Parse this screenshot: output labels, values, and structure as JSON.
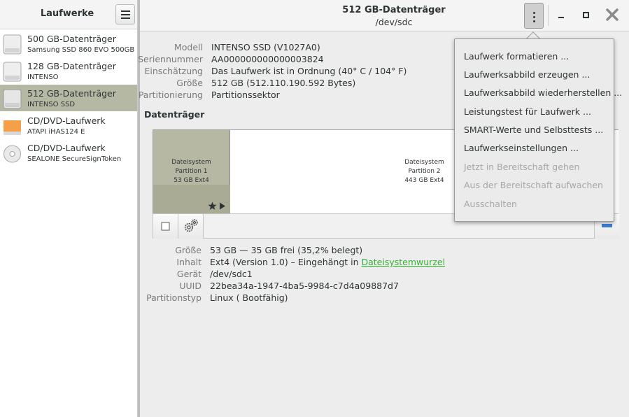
{
  "sidebar": {
    "title": "Laufwerke",
    "drives": [
      {
        "name": "500 GB-Datenträger",
        "sub": "Samsung SSD 860 EVO 500GB",
        "icon": "hard-disk-icon"
      },
      {
        "name": "128 GB-Datenträger",
        "sub": "INTENSO",
        "icon": "hard-disk-icon"
      },
      {
        "name": "512 GB-Datenträger",
        "sub": "INTENSO SSD",
        "icon": "hard-disk-icon",
        "selected": true
      },
      {
        "name": "CD/DVD-Laufwerk",
        "sub": "ATAPI   iHAS124   E",
        "icon": "optical-drive-icon"
      },
      {
        "name": "CD/DVD-Laufwerk",
        "sub": "SEALONE SecureSignToken",
        "icon": "optical-disc-icon"
      }
    ]
  },
  "header": {
    "title": "512 GB-Datenträger",
    "subtitle": "/dev/sdc"
  },
  "drive_info": [
    {
      "label": "Modell",
      "value": "INTENSO SSD (V1027A0)"
    },
    {
      "label": "Seriennummer",
      "value": "AA000000000000003824"
    },
    {
      "label": "Einschätzung",
      "value": "Das Laufwerk ist in Ordnung (40° C / 104° F)"
    },
    {
      "label": "Größe",
      "value": "512 GB (512.110.190.592 Bytes)"
    },
    {
      "label": "Partitionierung",
      "value": "Partitionssektor"
    }
  ],
  "volumes": {
    "section_title": "Datenträger",
    "partitions": [
      {
        "line1": "Dateisystem",
        "line2": "Partition 1",
        "line3": "53 GB Ext4"
      },
      {
        "line1": "Dateisystem",
        "line2": "Partition 2",
        "line3": "443 GB Ext4"
      }
    ]
  },
  "partition_info": [
    {
      "label": "Größe",
      "value": "53 GB — 35 GB frei (35,2% belegt)"
    },
    {
      "label": "Inhalt",
      "value": "Ext4 (Version 1.0) – Eingehängt in ",
      "link": "Dateisystemwurzel"
    },
    {
      "label": "Gerät",
      "value": "/dev/sdc1"
    },
    {
      "label": "UUID",
      "value": "22bea34a-1947-4ba5-9984-c7d4a09887d7"
    },
    {
      "label": "Partitionstyp",
      "value": "Linux ( Bootfähig)"
    }
  ],
  "menu": {
    "items": [
      {
        "label": "Laufwerk formatieren ...",
        "enabled": true
      },
      {
        "label": "Laufwerksabbild erzeugen ...",
        "enabled": true
      },
      {
        "label": "Laufwerksabbild wiederherstellen ...",
        "enabled": true
      },
      {
        "label": "Leistungstest für Laufwerk ...",
        "enabled": true
      },
      {
        "label": "SMART-Werte und Selbsttests ...",
        "enabled": true
      },
      {
        "label": "Laufwerkseinstellungen ...",
        "enabled": true
      },
      {
        "label": "Jetzt in Bereitschaft gehen",
        "enabled": false
      },
      {
        "label": "Aus der Bereitschaft aufwachen",
        "enabled": false
      },
      {
        "label": "Ausschalten",
        "enabled": false
      }
    ]
  },
  "colors": {
    "selection": "#b5b9a3",
    "link": "#33b333",
    "partition": "#b6b8a4"
  }
}
